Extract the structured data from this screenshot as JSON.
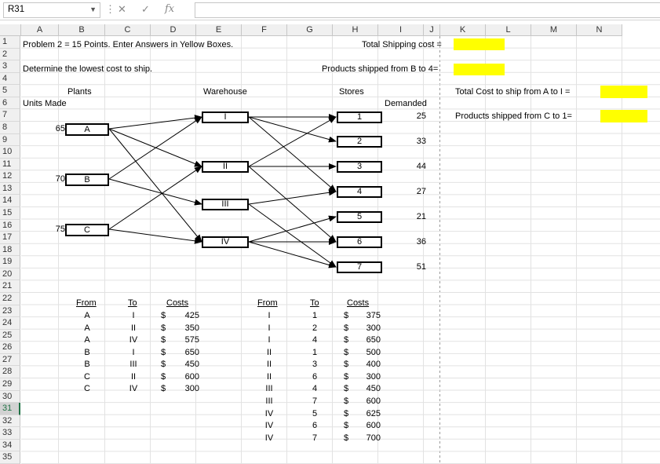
{
  "formula_bar": {
    "name_box": "R31",
    "fx_label": "fx",
    "formula": ""
  },
  "columns": [
    "A",
    "B",
    "C",
    "D",
    "E",
    "F",
    "G",
    "H",
    "I",
    "J",
    "K",
    "L",
    "M",
    "N"
  ],
  "rows": [
    "1",
    "2",
    "3",
    "4",
    "5",
    "6",
    "7",
    "8",
    "9",
    "10",
    "11",
    "12",
    "13",
    "14",
    "15",
    "16",
    "17",
    "18",
    "19",
    "20",
    "21",
    "22",
    "23",
    "24",
    "25",
    "26",
    "27",
    "28",
    "29",
    "30",
    "31",
    "32",
    "33",
    "34",
    "35"
  ],
  "selected_row": "31",
  "text": {
    "problem": "Problem 2 = 15 Points.  Enter Answers in Yellow Boxes.",
    "determine": "Determine the lowest cost to ship.",
    "total_shipping": "Total Shipping cost =",
    "products_b4": "Products shipped from B to 4=",
    "plants": "Plants",
    "units_made": "Units Made",
    "warehouse": "Warehouse",
    "stores": "Stores",
    "demanded": "Demanded",
    "total_cost_ai": "Total Cost to ship from A to I =",
    "products_c1": "Products shipped from C to 1="
  },
  "plants": [
    {
      "name": "A",
      "units": "65"
    },
    {
      "name": "B",
      "units": "70"
    },
    {
      "name": "C",
      "units": "75"
    }
  ],
  "warehouses": [
    "I",
    "II",
    "III",
    "IV"
  ],
  "stores": [
    {
      "name": "1",
      "demand": "25"
    },
    {
      "name": "2",
      "demand": "33"
    },
    {
      "name": "3",
      "demand": "44"
    },
    {
      "name": "4",
      "demand": "27"
    },
    {
      "name": "5",
      "demand": "21"
    },
    {
      "name": "6",
      "demand": "36"
    },
    {
      "name": "7",
      "demand": "51"
    }
  ],
  "table1": {
    "headers": {
      "from": "From",
      "to": "To",
      "costs": "Costs"
    },
    "rows": [
      {
        "from": "A",
        "to": "I",
        "cur": "$",
        "cost": "425"
      },
      {
        "from": "A",
        "to": "II",
        "cur": "$",
        "cost": "350"
      },
      {
        "from": "A",
        "to": "IV",
        "cur": "$",
        "cost": "575"
      },
      {
        "from": "B",
        "to": "I",
        "cur": "$",
        "cost": "650"
      },
      {
        "from": "B",
        "to": "III",
        "cur": "$",
        "cost": "450"
      },
      {
        "from": "C",
        "to": "II",
        "cur": "$",
        "cost": "600"
      },
      {
        "from": "C",
        "to": "IV",
        "cur": "$",
        "cost": "300"
      }
    ]
  },
  "table2": {
    "headers": {
      "from": "From",
      "to": "To",
      "costs": "Costs"
    },
    "rows": [
      {
        "from": "I",
        "to": "1",
        "cur": "$",
        "cost": "375"
      },
      {
        "from": "I",
        "to": "2",
        "cur": "$",
        "cost": "300"
      },
      {
        "from": "I",
        "to": "4",
        "cur": "$",
        "cost": "650"
      },
      {
        "from": "II",
        "to": "1",
        "cur": "$",
        "cost": "500"
      },
      {
        "from": "II",
        "to": "3",
        "cur": "$",
        "cost": "400"
      },
      {
        "from": "II",
        "to": "6",
        "cur": "$",
        "cost": "300"
      },
      {
        "from": "III",
        "to": "4",
        "cur": "$",
        "cost": "450"
      },
      {
        "from": "III",
        "to": "7",
        "cur": "$",
        "cost": "600"
      },
      {
        "from": "IV",
        "to": "5",
        "cur": "$",
        "cost": "625"
      },
      {
        "from": "IV",
        "to": "6",
        "cur": "$",
        "cost": "600"
      },
      {
        "from": "IV",
        "to": "7",
        "cur": "$",
        "cost": "700"
      }
    ]
  },
  "colors": {
    "answer_box": "#ffff00",
    "selection": "#217346",
    "gridline": "#d8d8d8"
  },
  "icons": [
    "dropdown-arrow-icon",
    "more-vert-icon",
    "cancel-icon",
    "enter-check-icon",
    "function-icon"
  ]
}
